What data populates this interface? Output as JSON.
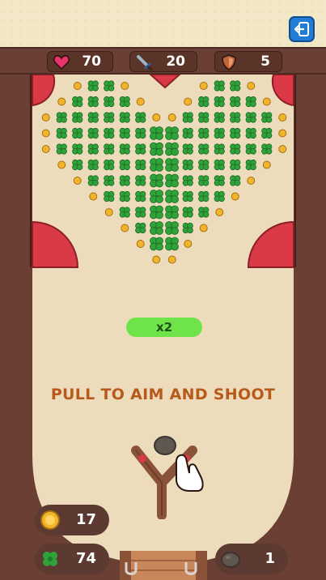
{
  "stats": {
    "health": {
      "icon": "heart-icon",
      "value": "70"
    },
    "attack": {
      "icon": "sword-icon",
      "value": "20"
    },
    "defense": {
      "icon": "shield-icon",
      "value": "5"
    }
  },
  "multiplier": {
    "label": "x2"
  },
  "instruction": "PULL TO AIM AND SHOOT",
  "inventory": {
    "coins": {
      "icon": "coin-icon",
      "value": "17"
    },
    "clovers": {
      "icon": "clover-icon",
      "value": "74"
    },
    "rocks": {
      "icon": "rock-icon",
      "value": "1"
    }
  },
  "colors": {
    "frame": "#6b3f34",
    "board": "#ecdcbc",
    "bumper": "#d93a45",
    "clover": "#2fa23a",
    "coin": "#f1b52c",
    "accent_green": "#6ee44a",
    "instruction": "#b85a1c"
  }
}
